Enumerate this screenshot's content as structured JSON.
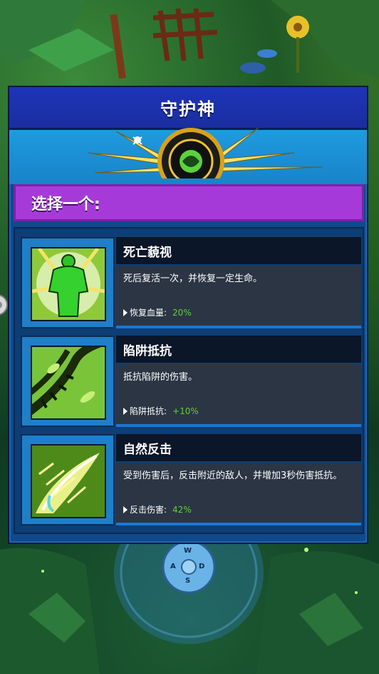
{
  "panel": {
    "title": "守护神",
    "select_prompt": "选择一个:"
  },
  "options": [
    {
      "name": "死亡藐视",
      "description": "死后复活一次，并恢复一定生命。",
      "stat_label": "恢复血量:",
      "stat_value": "20%",
      "icon": "green-figure-icon"
    },
    {
      "name": "陷阱抵抗",
      "description": "抵抗陷阱的伤害。",
      "stat_label": "陷阱抵抗:",
      "stat_value": "+10%",
      "icon": "thorny-vine-icon"
    },
    {
      "name": "自然反击",
      "description": "受到伤害后，反击附近的敌人，并增加3秒伤害抵抗。",
      "stat_label": "反击伤害:",
      "stat_value": "42%",
      "icon": "leaf-slash-icon"
    }
  ],
  "joystick": {
    "up": "W",
    "left": "A",
    "right": "D",
    "down": "S"
  },
  "colors": {
    "title_bar": "#1e34b8",
    "select_bar": "#a63ad9",
    "stat_value": "#5fd13a",
    "emblem_bg": "#1f9bdf"
  }
}
